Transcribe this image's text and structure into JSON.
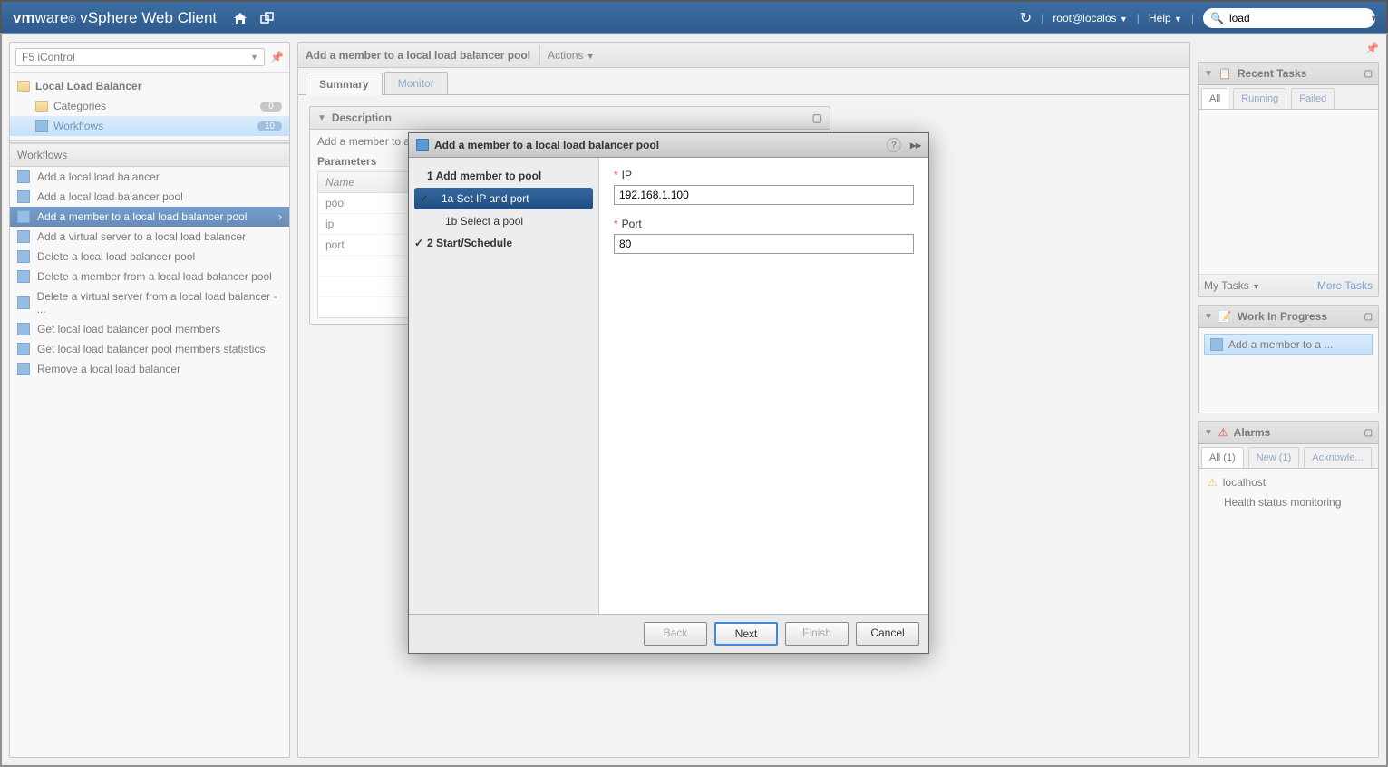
{
  "header": {
    "logo_prefix": "vm",
    "logo_mid": "ware",
    "logo_suffix": "vSphere Web Client",
    "user": "root@localos",
    "help": "Help",
    "search_value": "load"
  },
  "left": {
    "selector": "F5 iControl",
    "root": "Local Load Balancer",
    "categories": {
      "label": "Categories",
      "count": "0"
    },
    "workflows": {
      "label": "Workflows",
      "count": "10"
    },
    "list_header": "Workflows",
    "items": [
      "Add a local load balancer",
      "Add a local load balancer pool",
      "Add a member to a local load balancer pool",
      "Add a virtual server to a local load balancer",
      "Delete a local load balancer pool",
      "Delete a member from a local load balancer pool",
      "Delete a virtual server from a local load balancer  - ...",
      "Get local load balancer pool members",
      "Get local load balancer pool members statistics",
      "Remove a local load balancer"
    ],
    "selected_index": 2
  },
  "main": {
    "title": "Add a member to a local load balancer pool",
    "actions": "Actions",
    "tabs": [
      "Summary",
      "Monitor"
    ],
    "active_tab": 0,
    "panel_title": "Description",
    "desc_line": "Add a member to a",
    "params_title": "Parameters",
    "param_header": "Name",
    "params": [
      "pool",
      "ip",
      "port"
    ]
  },
  "modal": {
    "title": "Add a member to a local load balancer pool",
    "steps": {
      "s1": "1  Add member to pool",
      "s1a": "1a  Set IP and port",
      "s1b": "1b  Select a pool",
      "s2": "2  Start/Schedule"
    },
    "form": {
      "ip_label": "IP",
      "ip_value": "192.168.1.100",
      "port_label": "Port",
      "port_value": "80"
    },
    "buttons": {
      "back": "Back",
      "next": "Next",
      "finish": "Finish",
      "cancel": "Cancel"
    }
  },
  "right": {
    "recent": {
      "title": "Recent Tasks",
      "tabs": [
        "All",
        "Running",
        "Failed"
      ],
      "my_tasks": "My Tasks",
      "more": "More Tasks"
    },
    "wip": {
      "title": "Work In Progress",
      "item": "Add a member to a ..."
    },
    "alarms": {
      "title": "Alarms",
      "tabs": [
        "All (1)",
        "New (1)",
        "Acknowle..."
      ],
      "host": "localhost",
      "msg": "Health status monitoring"
    }
  }
}
